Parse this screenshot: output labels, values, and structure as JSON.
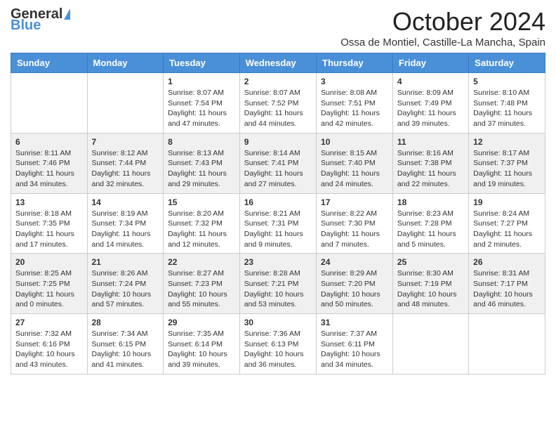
{
  "header": {
    "logo_general": "General",
    "logo_blue": "Blue",
    "month_title": "October 2024",
    "location": "Ossa de Montiel, Castille-La Mancha, Spain"
  },
  "days_of_week": [
    "Sunday",
    "Monday",
    "Tuesday",
    "Wednesday",
    "Thursday",
    "Friday",
    "Saturday"
  ],
  "weeks": [
    [
      {
        "day": "",
        "content": ""
      },
      {
        "day": "",
        "content": ""
      },
      {
        "day": "1",
        "content": "Sunrise: 8:07 AM\nSunset: 7:54 PM\nDaylight: 11 hours and 47 minutes."
      },
      {
        "day": "2",
        "content": "Sunrise: 8:07 AM\nSunset: 7:52 PM\nDaylight: 11 hours and 44 minutes."
      },
      {
        "day": "3",
        "content": "Sunrise: 8:08 AM\nSunset: 7:51 PM\nDaylight: 11 hours and 42 minutes."
      },
      {
        "day": "4",
        "content": "Sunrise: 8:09 AM\nSunset: 7:49 PM\nDaylight: 11 hours and 39 minutes."
      },
      {
        "day": "5",
        "content": "Sunrise: 8:10 AM\nSunset: 7:48 PM\nDaylight: 11 hours and 37 minutes."
      }
    ],
    [
      {
        "day": "6",
        "content": "Sunrise: 8:11 AM\nSunset: 7:46 PM\nDaylight: 11 hours and 34 minutes."
      },
      {
        "day": "7",
        "content": "Sunrise: 8:12 AM\nSunset: 7:44 PM\nDaylight: 11 hours and 32 minutes."
      },
      {
        "day": "8",
        "content": "Sunrise: 8:13 AM\nSunset: 7:43 PM\nDaylight: 11 hours and 29 minutes."
      },
      {
        "day": "9",
        "content": "Sunrise: 8:14 AM\nSunset: 7:41 PM\nDaylight: 11 hours and 27 minutes."
      },
      {
        "day": "10",
        "content": "Sunrise: 8:15 AM\nSunset: 7:40 PM\nDaylight: 11 hours and 24 minutes."
      },
      {
        "day": "11",
        "content": "Sunrise: 8:16 AM\nSunset: 7:38 PM\nDaylight: 11 hours and 22 minutes."
      },
      {
        "day": "12",
        "content": "Sunrise: 8:17 AM\nSunset: 7:37 PM\nDaylight: 11 hours and 19 minutes."
      }
    ],
    [
      {
        "day": "13",
        "content": "Sunrise: 8:18 AM\nSunset: 7:35 PM\nDaylight: 11 hours and 17 minutes."
      },
      {
        "day": "14",
        "content": "Sunrise: 8:19 AM\nSunset: 7:34 PM\nDaylight: 11 hours and 14 minutes."
      },
      {
        "day": "15",
        "content": "Sunrise: 8:20 AM\nSunset: 7:32 PM\nDaylight: 11 hours and 12 minutes."
      },
      {
        "day": "16",
        "content": "Sunrise: 8:21 AM\nSunset: 7:31 PM\nDaylight: 11 hours and 9 minutes."
      },
      {
        "day": "17",
        "content": "Sunrise: 8:22 AM\nSunset: 7:30 PM\nDaylight: 11 hours and 7 minutes."
      },
      {
        "day": "18",
        "content": "Sunrise: 8:23 AM\nSunset: 7:28 PM\nDaylight: 11 hours and 5 minutes."
      },
      {
        "day": "19",
        "content": "Sunrise: 8:24 AM\nSunset: 7:27 PM\nDaylight: 11 hours and 2 minutes."
      }
    ],
    [
      {
        "day": "20",
        "content": "Sunrise: 8:25 AM\nSunset: 7:25 PM\nDaylight: 11 hours and 0 minutes."
      },
      {
        "day": "21",
        "content": "Sunrise: 8:26 AM\nSunset: 7:24 PM\nDaylight: 10 hours and 57 minutes."
      },
      {
        "day": "22",
        "content": "Sunrise: 8:27 AM\nSunset: 7:23 PM\nDaylight: 10 hours and 55 minutes."
      },
      {
        "day": "23",
        "content": "Sunrise: 8:28 AM\nSunset: 7:21 PM\nDaylight: 10 hours and 53 minutes."
      },
      {
        "day": "24",
        "content": "Sunrise: 8:29 AM\nSunset: 7:20 PM\nDaylight: 10 hours and 50 minutes."
      },
      {
        "day": "25",
        "content": "Sunrise: 8:30 AM\nSunset: 7:19 PM\nDaylight: 10 hours and 48 minutes."
      },
      {
        "day": "26",
        "content": "Sunrise: 8:31 AM\nSunset: 7:17 PM\nDaylight: 10 hours and 46 minutes."
      }
    ],
    [
      {
        "day": "27",
        "content": "Sunrise: 7:32 AM\nSunset: 6:16 PM\nDaylight: 10 hours and 43 minutes."
      },
      {
        "day": "28",
        "content": "Sunrise: 7:34 AM\nSunset: 6:15 PM\nDaylight: 10 hours and 41 minutes."
      },
      {
        "day": "29",
        "content": "Sunrise: 7:35 AM\nSunset: 6:14 PM\nDaylight: 10 hours and 39 minutes."
      },
      {
        "day": "30",
        "content": "Sunrise: 7:36 AM\nSunset: 6:13 PM\nDaylight: 10 hours and 36 minutes."
      },
      {
        "day": "31",
        "content": "Sunrise: 7:37 AM\nSunset: 6:11 PM\nDaylight: 10 hours and 34 minutes."
      },
      {
        "day": "",
        "content": ""
      },
      {
        "day": "",
        "content": ""
      }
    ]
  ]
}
